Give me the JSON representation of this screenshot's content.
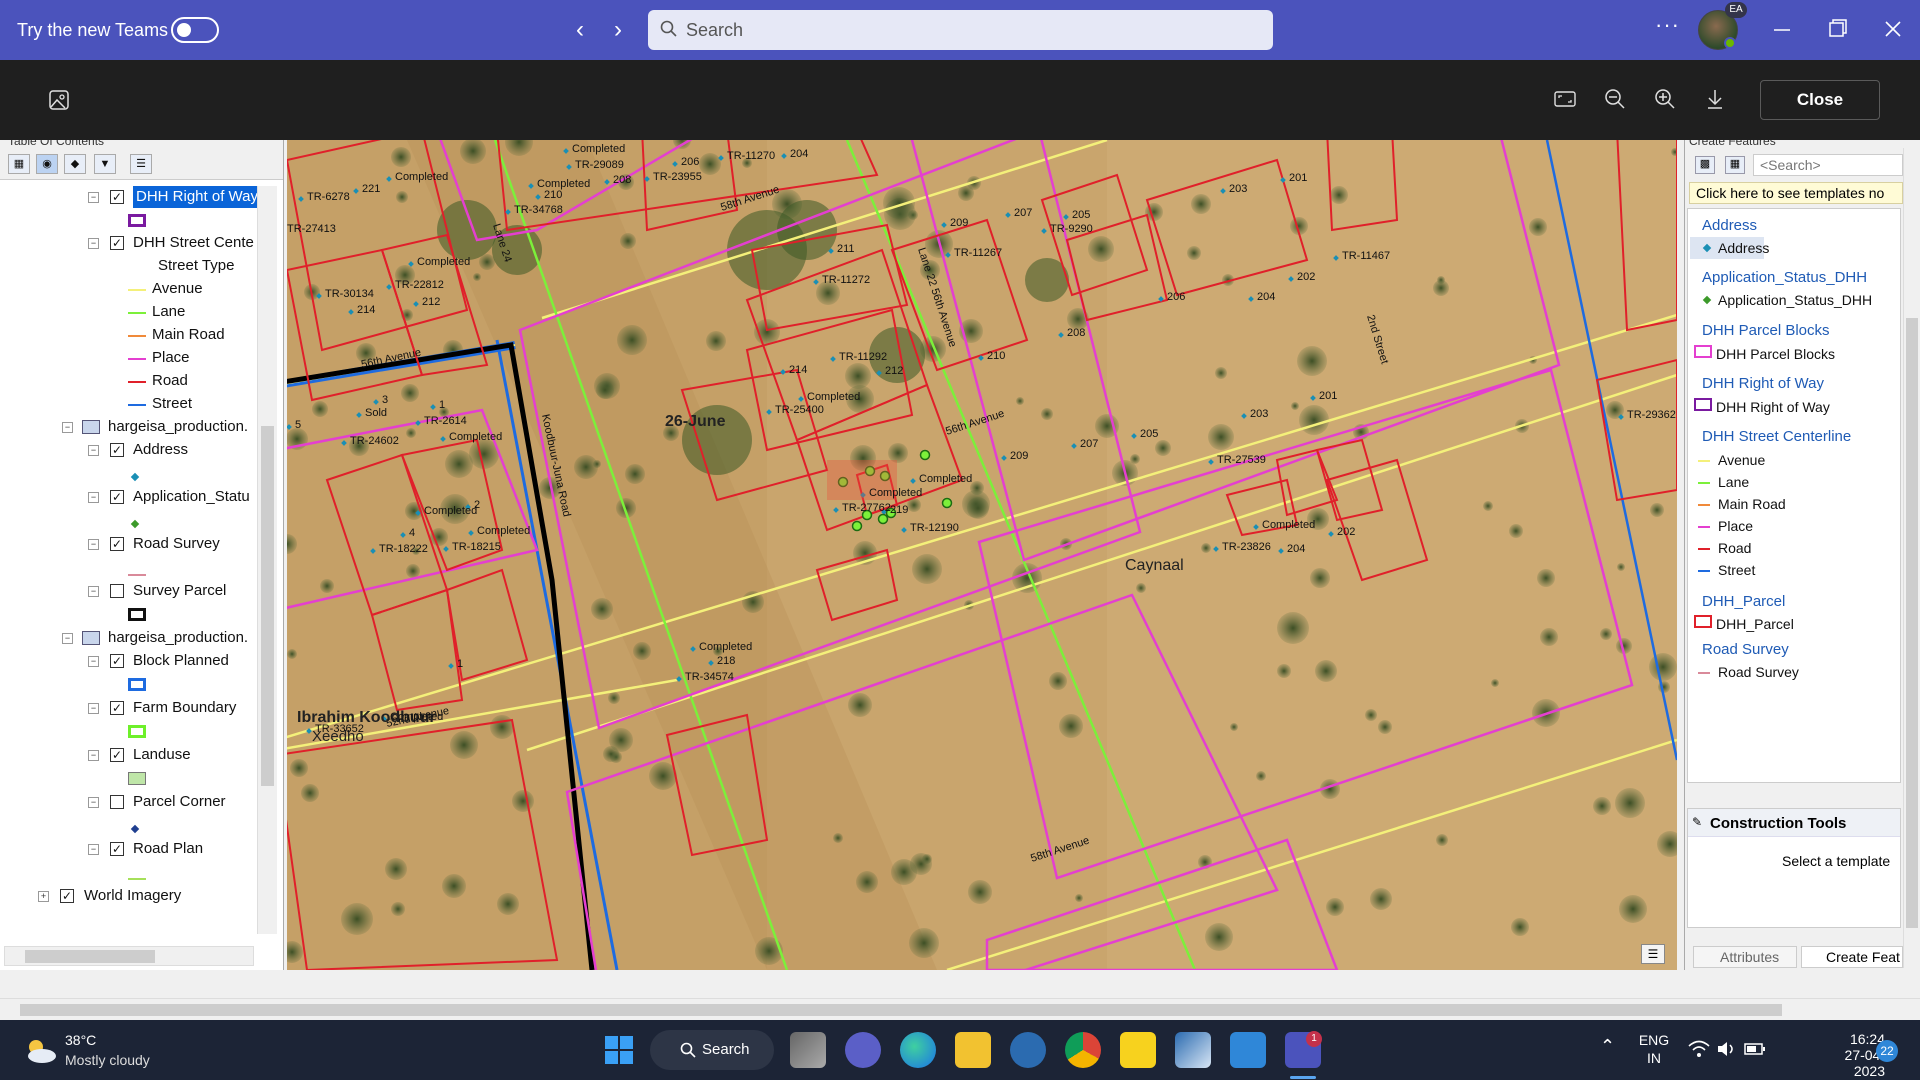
{
  "teams": {
    "promo_text": "Try the new Teams",
    "search_placeholder": "Search",
    "avatar_initials": "EA",
    "more_label": "···"
  },
  "viewer": {
    "close_label": "Close"
  },
  "toc": {
    "title": "Table Of Contents",
    "rows": {
      "dhh_row": "DHH Right of Way",
      "dhh_street": "DHH Street Cente",
      "street_type": "Street Type",
      "avenue": "Avenue",
      "lane": "Lane",
      "main_road": "Main Road",
      "place": "Place",
      "road": "Road",
      "street": "Street",
      "group1": "hargeisa_production.",
      "address": "Address",
      "app_status": "Application_Statu",
      "road_survey": "Road Survey",
      "survey_parcel": "Survey Parcel",
      "group2": "hargeisa_production.",
      "block_planned": "Block Planned",
      "farm_boundary": "Farm Boundary",
      "landuse": "Landuse",
      "parcel_corner": "Parcel Corner",
      "road_plan": "Road Plan",
      "world_imagery": "World Imagery"
    }
  },
  "map": {
    "roads": {
      "r58": "58th Avenue",
      "r56": "56th Avenue",
      "r52": "52nd Avenue",
      "r58b": "58th Avenue",
      "lane24": "Lane 24",
      "lane2256": "Lane 22 56th Avenue",
      "koodbuur": "Koodbuur-Juna Road",
      "second": "2nd Street",
      "s56": "56th Avenue"
    },
    "places": {
      "june26": "26-June",
      "caynaal": "Caynaal",
      "ibrahim": "Ibrahim Koodbuur",
      "xeedho": "Xeedho"
    },
    "labels": [
      "TR-6278",
      "221",
      "Completed",
      "TR-27413",
      "TR-30134",
      "214",
      "TR-22812",
      "212",
      "Completed",
      "Completed",
      "TR-29089",
      "208",
      "Completed",
      "210",
      "TR-34768",
      "206",
      "TR-23955",
      "TR-11270",
      "204",
      "211",
      "TR-11272",
      "214",
      "TR-11292",
      "212",
      "TR-25400",
      "Completed",
      "209",
      "TR-11267",
      "207",
      "205",
      "TR-9290",
      "203",
      "201",
      "202",
      "204",
      "206",
      "208",
      "210",
      "TR-11467",
      "Sold",
      "3",
      "1",
      "TR-2614",
      "TR-24602",
      "Completed",
      "5",
      "Completed",
      "2",
      "4",
      "TR-18222",
      "TR-18215",
      "Completed",
      "Completed",
      "TR-27762",
      "219",
      "TR-12190",
      "Completed",
      "209",
      "207",
      "205",
      "203",
      "201",
      "TR-27539",
      "Completed",
      "TR-23826",
      "204",
      "202",
      "TR-29362",
      "Completed",
      "218",
      "TR-34574",
      "1",
      "TR-33652",
      "Completed"
    ]
  },
  "create_features": {
    "title": "Create Features",
    "search_placeholder": "<Search>",
    "hint": "Click here to see templates no",
    "groups": {
      "address": "Address",
      "address_item": "Address",
      "app": "Application_Status_DHH",
      "app_item": "Application_Status_DHH",
      "blocks": "DHH Parcel Blocks",
      "blocks_item": "DHH Parcel Blocks",
      "row": "DHH Right of Way",
      "row_item": "DHH Right of Way",
      "street": "DHH Street Centerline",
      "avenue": "Avenue",
      "lane": "Lane",
      "main_road": "Main Road",
      "place": "Place",
      "road": "Road",
      "streetitem": "Street",
      "parcel": "DHH_Parcel",
      "parcel_item": "DHH_Parcel",
      "survey": "Road Survey",
      "survey_item": "Road Survey"
    },
    "construction_title": "Construction Tools",
    "construction_hint": "Select a template",
    "tab_attributes": "Attributes",
    "tab_create": "Create Feat"
  },
  "taskbar": {
    "temp": "38°C",
    "weather": "Mostly cloudy",
    "search": "Search",
    "lang1": "ENG",
    "lang2": "IN",
    "time": "16:24",
    "date": "27-04-2023",
    "notif": "22",
    "teams_badge": "1"
  },
  "colors": {
    "teams_bar": "#4b53bc",
    "parcel_red": "#e0202a",
    "block_magenta": "#e43fd0",
    "lane_green": "#7cf03a",
    "avenue_yellow": "#f4f07a",
    "street_blue": "#1e6be0"
  }
}
